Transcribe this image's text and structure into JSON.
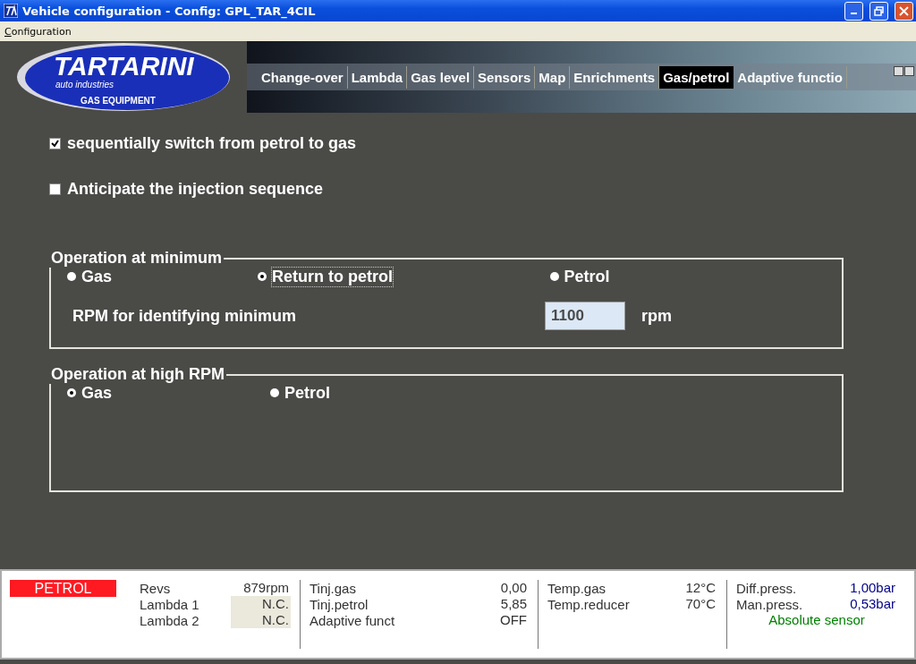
{
  "window": {
    "title": "Vehicle configuration - Config: GPL_TAR_4CIL"
  },
  "menu": [
    {
      "label": "Configuration"
    }
  ],
  "logo": {
    "name": "TARTARINI",
    "subtitle": "auto industries",
    "tagline": "GAS EQUIPMENT"
  },
  "tabs": [
    {
      "label": "Change-over",
      "selected": false
    },
    {
      "label": "Lambda",
      "selected": false
    },
    {
      "label": "Gas level",
      "selected": false
    },
    {
      "label": "Sensors",
      "selected": false
    },
    {
      "label": "Map",
      "selected": false
    },
    {
      "label": "Enrichments",
      "selected": false
    },
    {
      "label": "Gas/petrol",
      "selected": true
    },
    {
      "label": "Adaptive functio",
      "selected": false
    }
  ],
  "options": [
    {
      "label": "sequentially switch from petrol to gas",
      "checked": true
    },
    {
      "label": "Anticipate the injection sequence",
      "checked": false
    }
  ],
  "groups": [
    {
      "title": "Operation at minimum",
      "radios": [
        {
          "label": "Gas",
          "selected": false,
          "focused": false
        },
        {
          "label": "Return to petrol",
          "selected": true,
          "focused": true
        },
        {
          "label": "Petrol",
          "selected": false,
          "focused": false
        }
      ],
      "rpm_field": {
        "label": "RPM for identifying minimum",
        "value": "1100",
        "unit": "rpm"
      }
    },
    {
      "title": "Operation at high RPM",
      "radios": [
        {
          "label": "Gas",
          "selected": true,
          "focused": false
        },
        {
          "label": "Petrol",
          "selected": false,
          "focused": false
        }
      ]
    }
  ],
  "status": {
    "mode": "PETROL",
    "columns": [
      {
        "kind": "engine",
        "readings": [
          {
            "label": "Revs",
            "value": "879rpm",
            "shaded": false
          },
          {
            "label": "Lambda 1",
            "value": "N.C.",
            "shaded": true
          },
          {
            "label": "Lambda 2",
            "value": "N.C.",
            "shaded": true
          }
        ]
      },
      {
        "kind": "injection",
        "readings": [
          {
            "label": "Tinj.gas",
            "value": "0,00",
            "shaded": false
          },
          {
            "label": "Tinj.petrol",
            "value": "5,85",
            "shaded": false
          },
          {
            "label": "Adaptive funct",
            "value": "OFF",
            "shaded": false
          }
        ]
      },
      {
        "kind": "temperature",
        "readings": [
          {
            "label": "Temp.gas",
            "value": "12°C",
            "shaded": false
          },
          {
            "label": "Temp.reducer",
            "value": "70°C",
            "shaded": false
          }
        ]
      },
      {
        "kind": "pressure",
        "readings": [
          {
            "label": "Diff.press.",
            "value": "1,00bar",
            "shaded": false
          },
          {
            "label": "Man.press.",
            "value": "0,53bar",
            "shaded": false
          }
        ],
        "note": "Absolute sensor"
      }
    ]
  }
}
